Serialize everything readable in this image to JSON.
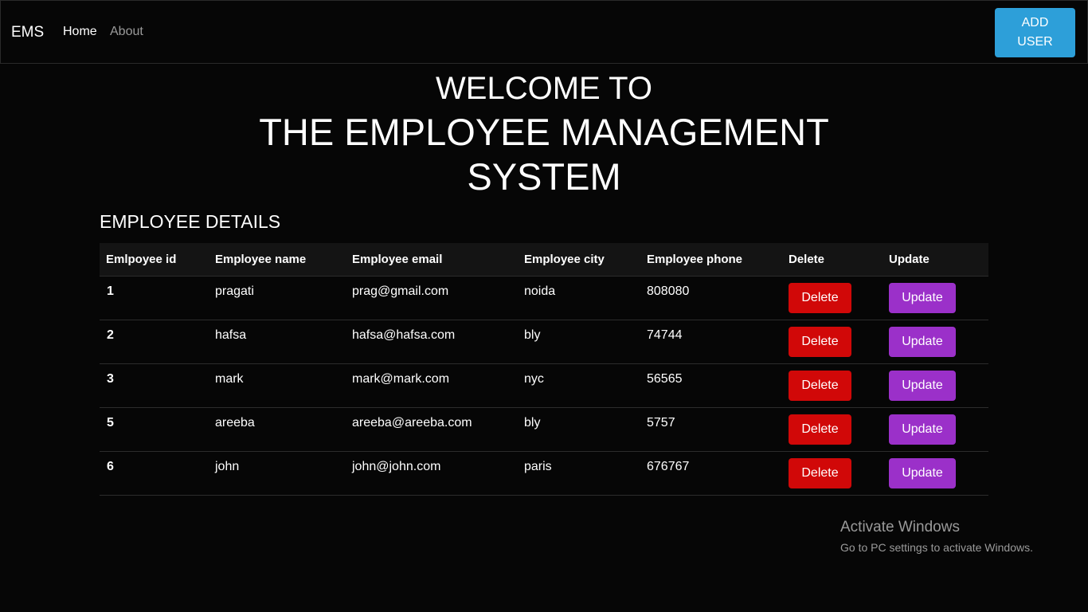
{
  "navbar": {
    "brand": "EMS",
    "links": [
      "Home",
      "About"
    ],
    "add_user_label": "ADD USER"
  },
  "hero": {
    "line1": "WELCOME TO",
    "line2": "THE EMPLOYEE MANAGEMENT SYSTEM"
  },
  "section_title": "EMPLOYEE DETAILS",
  "table": {
    "headers": [
      "Emlpoyee id",
      "Employee name",
      "Employee email",
      "Employee city",
      "Employee phone",
      "Delete",
      "Update"
    ],
    "rows": [
      {
        "id": "1",
        "name": "pragati",
        "email": "prag@gmail.com",
        "city": "noida",
        "phone": "808080"
      },
      {
        "id": "2",
        "name": "hafsa",
        "email": "hafsa@hafsa.com",
        "city": "bly",
        "phone": "74744"
      },
      {
        "id": "3",
        "name": "mark",
        "email": "mark@mark.com",
        "city": "nyc",
        "phone": "56565"
      },
      {
        "id": "5",
        "name": "areeba",
        "email": "areeba@areeba.com",
        "city": "bly",
        "phone": "5757"
      },
      {
        "id": "6",
        "name": "john",
        "email": "john@john.com",
        "city": "paris",
        "phone": "676767"
      }
    ],
    "delete_label": "Delete",
    "update_label": "Update"
  },
  "watermark": {
    "title": "Activate Windows",
    "subtitle": "Go to PC settings to activate Windows."
  },
  "colors": {
    "background": "#060606",
    "add_user": "#2d9fd9",
    "delete": "#d10808",
    "update": "#9b30c9"
  }
}
